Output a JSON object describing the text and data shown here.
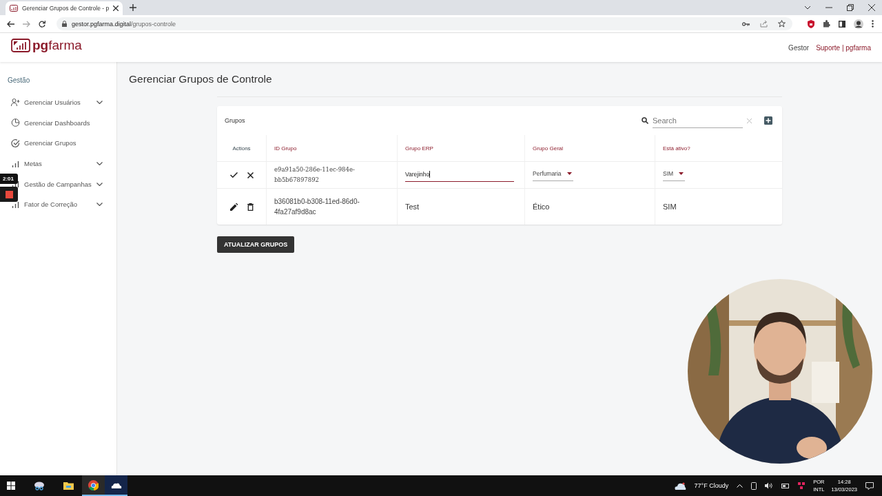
{
  "browser": {
    "tab_title": "Gerenciar Grupos de Controle - p",
    "url_host": "gestor.pgfarma.digital",
    "url_path": "/grupos-controle"
  },
  "header": {
    "logo_bold": "pg",
    "logo_light": "farma",
    "user": "Gestor",
    "support": "Suporte | pgfarma"
  },
  "sidebar": {
    "section": "Gestão",
    "items": [
      {
        "label": "Gerenciar Usuários",
        "expandable": true
      },
      {
        "label": "Gerenciar Dashboards",
        "expandable": false
      },
      {
        "label": "Gerenciar Grupos",
        "expandable": false
      },
      {
        "label": "Metas",
        "expandable": true
      },
      {
        "label": "Gestão de Campanhas",
        "expandable": true
      },
      {
        "label": "Fator de Correção",
        "expandable": true
      }
    ]
  },
  "recorder": {
    "time": "2:01"
  },
  "page_title": "Gerenciar Grupos de Controle",
  "table": {
    "title": "Grupos",
    "search": {
      "placeholder": "Search"
    },
    "columns": [
      "Actions",
      "ID Grupo",
      "Grupo ERP",
      "Grupo Geral",
      "Está ativo?"
    ],
    "rows": [
      {
        "kind": "edit",
        "id": "e9a91a50-286e-11ec-984e-bb5b67897892",
        "grupo_erp": "Varejinho",
        "grupo_geral": "Perfumaria",
        "ativo": "SIM"
      },
      {
        "kind": "view",
        "id": "b36081b0-b308-11ed-86d0-4fa27af9d8ac",
        "grupo_erp": "Test",
        "grupo_geral": "Ético",
        "ativo": "SIM"
      }
    ]
  },
  "update_button": "ATUALIZAR GRUPOS",
  "taskbar": {
    "weather": "77°F  Cloudy",
    "lang": [
      "POR",
      "INTL"
    ],
    "time": "14:28",
    "date": "13/03/2023"
  }
}
